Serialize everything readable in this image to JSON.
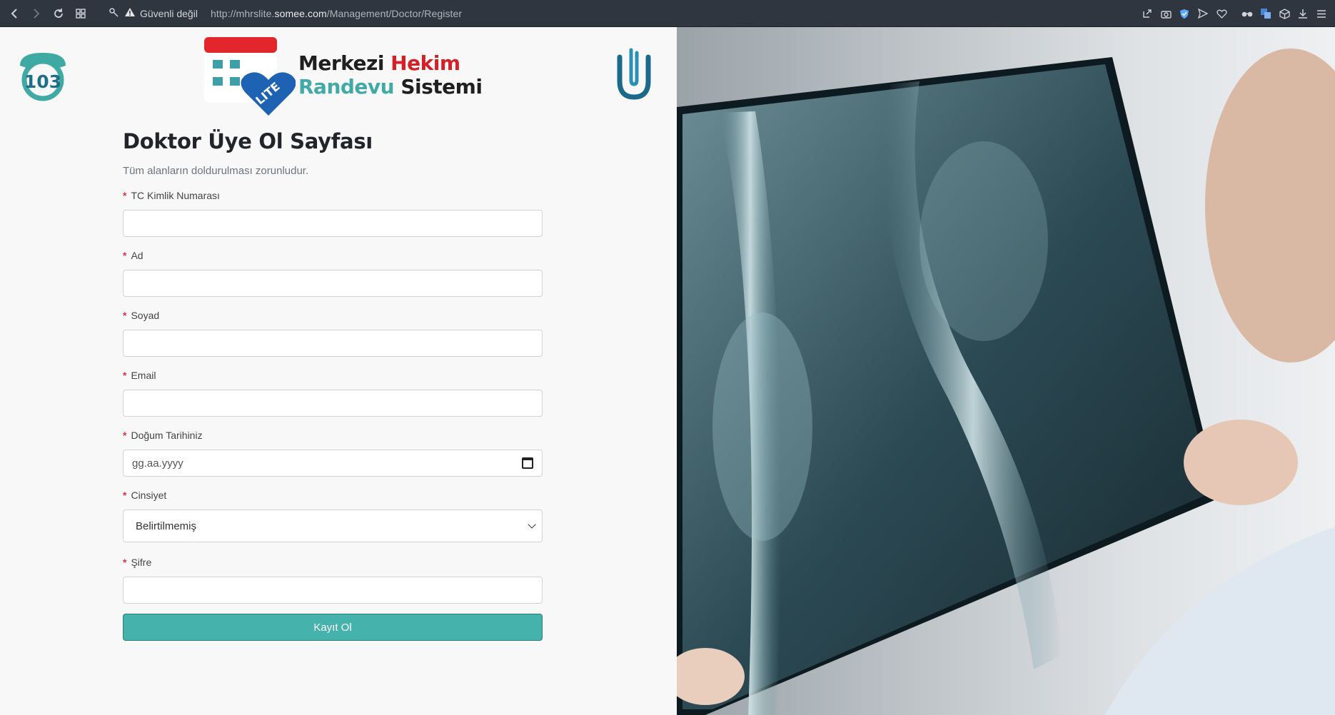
{
  "browser": {
    "security_text": "Güvenli değil",
    "url_prefix": "http://mhrslite.",
    "url_domain": "somee.com",
    "url_path": "/Management/Doctor/Register"
  },
  "logos": {
    "emergency_number": "103",
    "brand_line1_a": "Merkezi ",
    "brand_line1_b": "Hekim",
    "brand_line2_a": "Randevu ",
    "brand_line2_b": "Sistemi",
    "badge": "LITE"
  },
  "form": {
    "title": "Doktor Üye Ol Sayfası",
    "subtitle": "Tüm alanların doldurulması zorunludur.",
    "required_mark": "*",
    "fields": [
      {
        "label": "TC Kimlik Numarası",
        "value": ""
      },
      {
        "label": "Ad",
        "value": ""
      },
      {
        "label": "Soyad",
        "value": ""
      },
      {
        "label": "Email",
        "value": ""
      },
      {
        "label": "Doğum Tarihiniz",
        "placeholder": "gg.aa.yyyy"
      },
      {
        "label": "Cinsiyet",
        "selected": "Belirtilmemiş"
      },
      {
        "label": "Şifre",
        "value": ""
      }
    ],
    "submit_label": "Kayıt Ol"
  },
  "colors": {
    "accent": "#45b2ac",
    "required": "#dc3545",
    "brand_red": "#d42027",
    "brand_teal": "#42aaa6",
    "chrome": "#2f363f"
  },
  "icons": [
    "back-icon",
    "forward-icon",
    "reload-icon",
    "tabs-grid-icon",
    "key-icon",
    "warning-icon",
    "share-icon",
    "camera-icon",
    "shield-icon",
    "send-icon",
    "heart-icon",
    "glasses-icon",
    "translate-icon",
    "cube-icon",
    "download-icon",
    "menu-icon",
    "calendar-icon",
    "chevron-down-icon"
  ]
}
